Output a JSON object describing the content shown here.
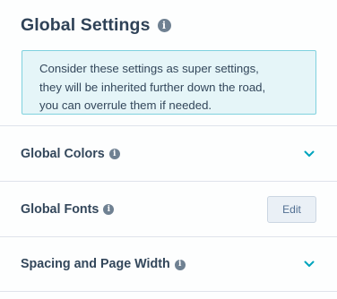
{
  "header": {
    "title": "Global Settings",
    "info_icon": "i"
  },
  "notice": {
    "lines": [
      "Consider these settings as super settings,",
      "they will be inherited further down the road,",
      "you can overrule them if needed."
    ]
  },
  "sections": {
    "colors": {
      "label": "Global Colors",
      "info_icon": "i",
      "action": "chevron-down-icon"
    },
    "fonts": {
      "label": "Global Fonts",
      "info_icon": "i",
      "button_label": "Edit"
    },
    "spacing": {
      "label": "Spacing and Page Width",
      "info_icon": "i",
      "action": "chevron-down-icon"
    }
  },
  "colors": {
    "accent": "#00a4bd",
    "text": "#33475b",
    "notice_bg": "#e5f5f8",
    "notice_border": "#7fd1de",
    "divider": "#dfe3eb",
    "button_bg": "#eaf0f6"
  }
}
